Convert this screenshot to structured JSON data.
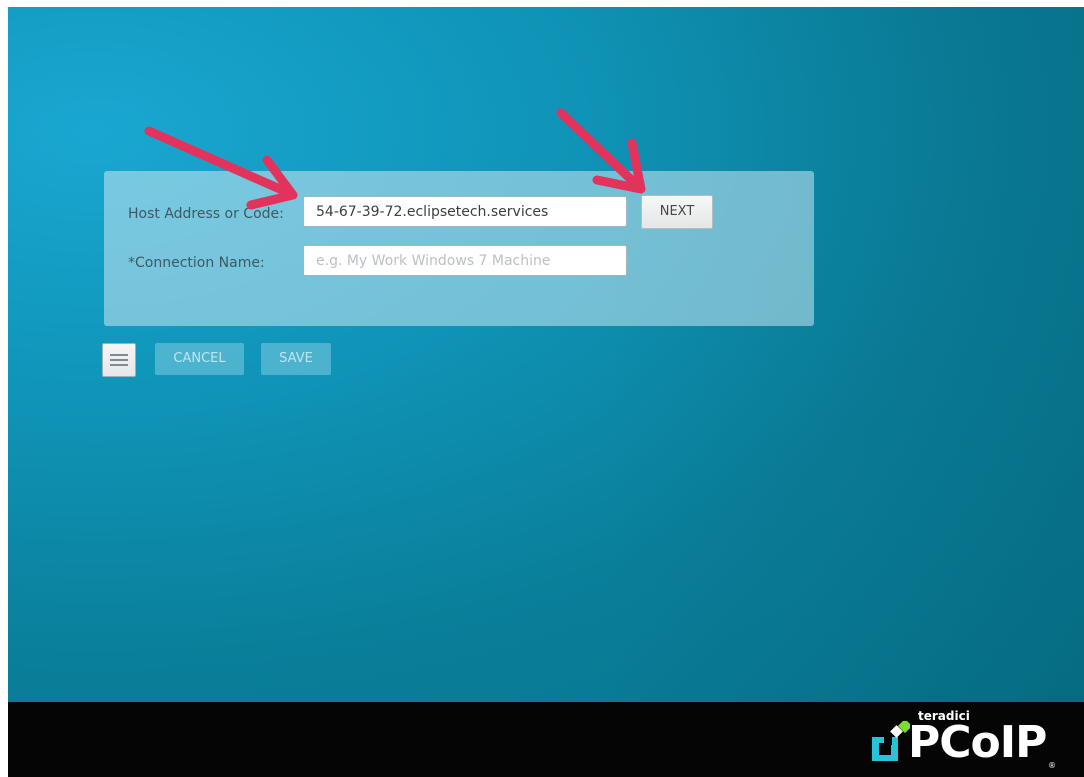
{
  "connection_form": {
    "host_label": "Host Address or Code:",
    "host_value": "54-67-39-72.eclipsetech.services",
    "name_label": "*Connection Name:",
    "name_placeholder": "e.g. My Work Windows 7 Machine",
    "name_value": ""
  },
  "buttons": {
    "next": "NEXT",
    "cancel": "CANCEL",
    "save": "SAVE"
  },
  "icons": {
    "menu": "hamburger-menu-icon",
    "logo_mark": "teradici-logo-icon",
    "annotation": "red-arrow-icon"
  },
  "logo": {
    "brand": "teradici",
    "product": "PCoIP",
    "registered": "®"
  },
  "colors": {
    "background_accent": "#0f93b6",
    "annotation_arrow": "#e2335c",
    "logo_green": "#7bdc2f",
    "logo_teal": "#29c3d8"
  }
}
